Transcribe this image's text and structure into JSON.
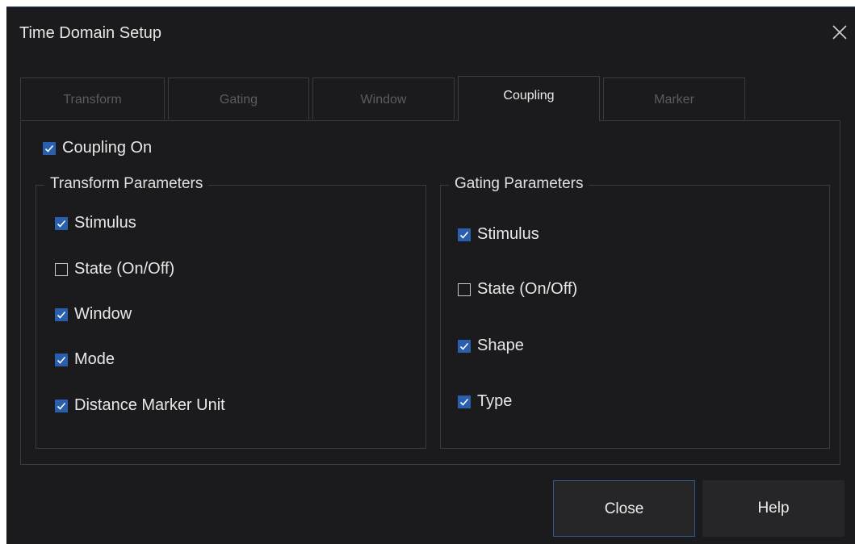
{
  "dialog": {
    "title": "Time Domain Setup"
  },
  "tabs": [
    {
      "label": "Transform",
      "active": false
    },
    {
      "label": "Gating",
      "active": false
    },
    {
      "label": "Window",
      "active": false
    },
    {
      "label": "Coupling",
      "active": true
    },
    {
      "label": "Marker",
      "active": false
    }
  ],
  "coupling_on": {
    "label": "Coupling On",
    "checked": true
  },
  "transform_parameters": {
    "title": "Transform Parameters",
    "items": [
      {
        "label": "Stimulus",
        "checked": true
      },
      {
        "label": "State (On/Off)",
        "checked": false
      },
      {
        "label": "Window",
        "checked": true
      },
      {
        "label": "Mode",
        "checked": true
      },
      {
        "label": "Distance Marker Unit",
        "checked": true
      }
    ]
  },
  "gating_parameters": {
    "title": "Gating Parameters",
    "items": [
      {
        "label": "Stimulus",
        "checked": true
      },
      {
        "label": "State (On/Off)",
        "checked": false
      },
      {
        "label": "Shape",
        "checked": true
      },
      {
        "label": "Type",
        "checked": true
      }
    ]
  },
  "buttons": {
    "close_label": "Close",
    "help_label": "Help"
  },
  "colors": {
    "background": "#1b1b1d",
    "accent": "#2a5fae",
    "border": "#3b3b3f"
  }
}
